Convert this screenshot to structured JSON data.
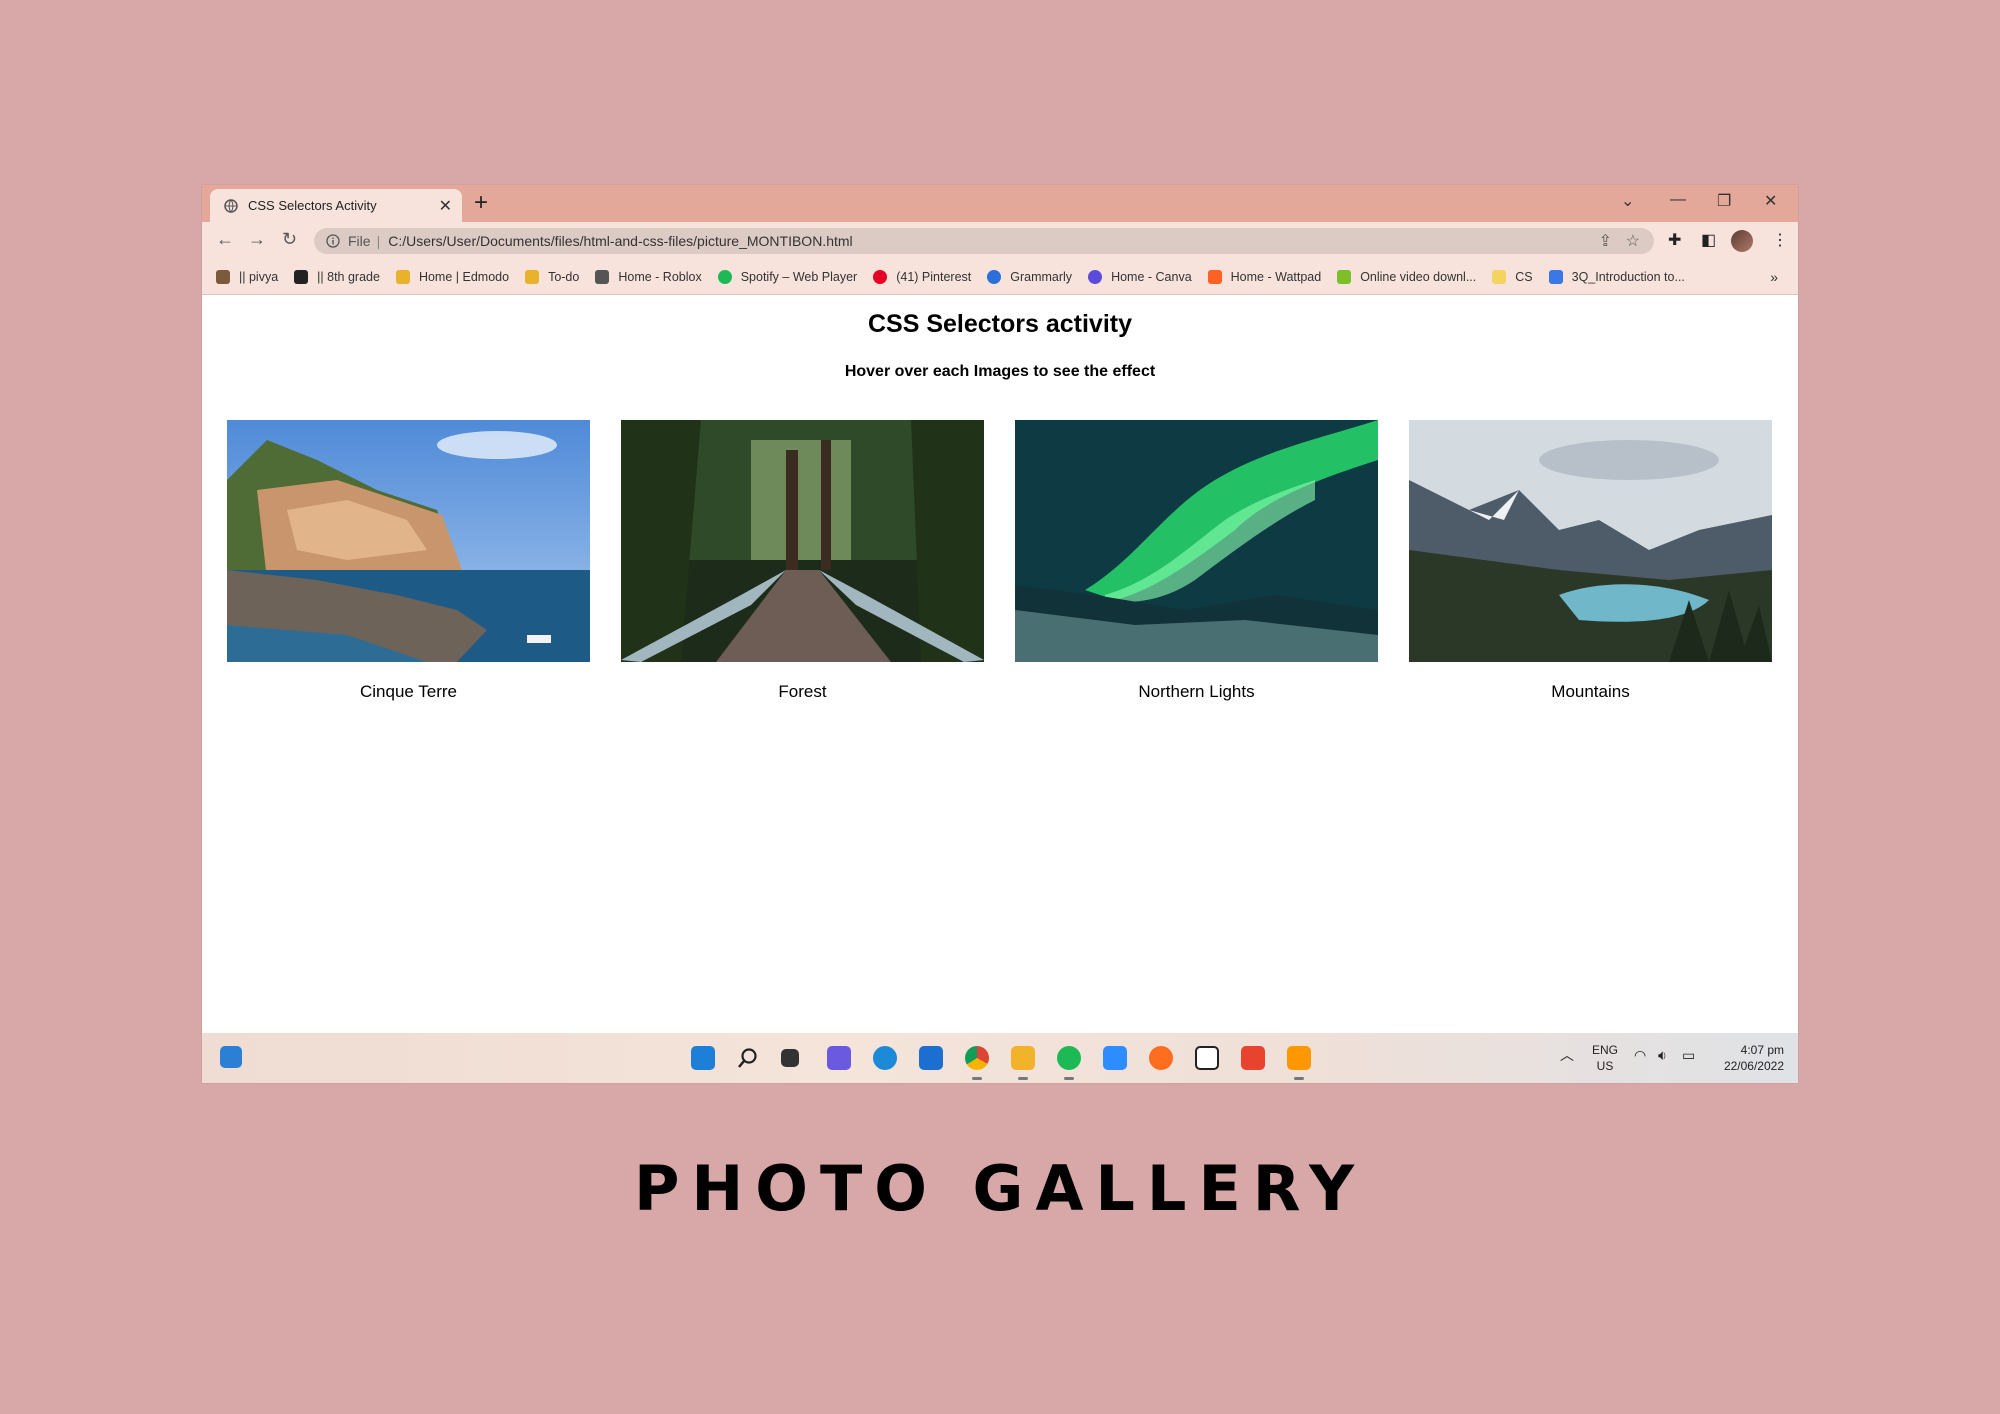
{
  "browser": {
    "tab_title": "CSS Selectors Activity",
    "address_scheme": "File",
    "address_path": "C:/Users/User/Documents/files/html-and-css-files/picture_MONTIBON.html"
  },
  "bookmarks": [
    {
      "label": "|| pivya",
      "color": "#7a5a3a"
    },
    {
      "label": "|| 8th grade",
      "color": "#222222"
    },
    {
      "label": "Home | Edmodo",
      "color": "#e8b22c"
    },
    {
      "label": "To-do",
      "color": "#e8b22c"
    },
    {
      "label": "Home - Roblox",
      "color": "#555555"
    },
    {
      "label": "Spotify – Web Player",
      "color": "#1db954"
    },
    {
      "label": "(41) Pinterest",
      "color": "#e60023"
    },
    {
      "label": "Grammarly",
      "color": "#2a6fdb"
    },
    {
      "label": "Home - Canva",
      "color": "#5b4bdb"
    },
    {
      "label": "Home - Wattpad",
      "color": "#ff6122"
    },
    {
      "label": "Online video downl...",
      "color": "#7cbf2a"
    },
    {
      "label": "CS",
      "color": "#f4d35e"
    },
    {
      "label": "3Q_Introduction to...",
      "color": "#3b78e7"
    }
  ],
  "page": {
    "heading": "CSS Selectors activity",
    "subheading": "Hover over each Images to see the effect",
    "gallery": [
      {
        "caption": "Cinque Terre"
      },
      {
        "caption": "Forest"
      },
      {
        "caption": "Northern Lights"
      },
      {
        "caption": "Mountains"
      }
    ]
  },
  "taskbar": {
    "language": "ENG",
    "region": "US",
    "time": "4:07 pm",
    "date": "22/06/2022"
  },
  "poster_title": "PHOTO GALLERY"
}
